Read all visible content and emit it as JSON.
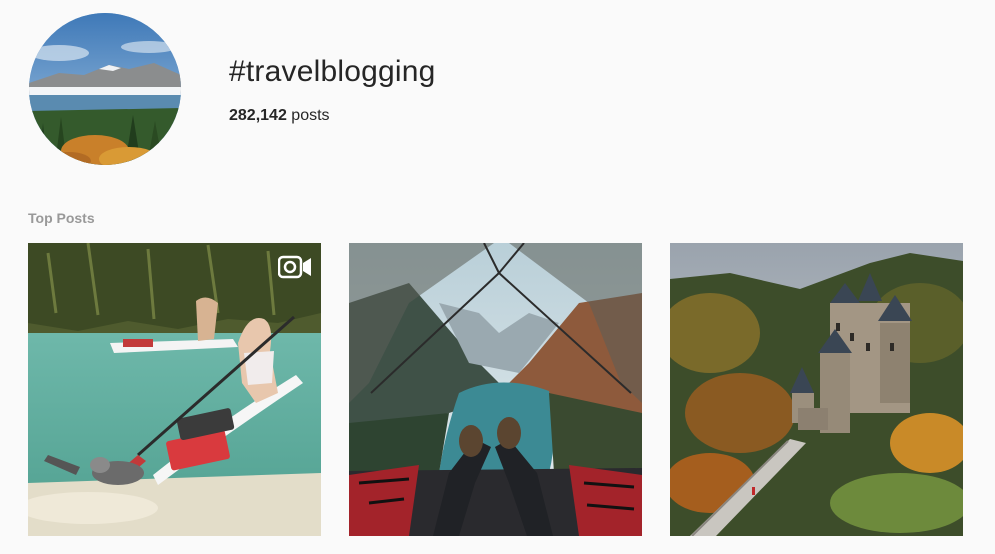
{
  "hashtag": {
    "title": "#travelblogging",
    "post_count": "282,142",
    "post_count_suffix": "posts"
  },
  "top_posts": {
    "label": "Top Posts",
    "posts": [
      {
        "type": "video",
        "badge_icon": "video-camera-icon"
      },
      {
        "type": "image"
      },
      {
        "type": "image"
      }
    ]
  }
}
